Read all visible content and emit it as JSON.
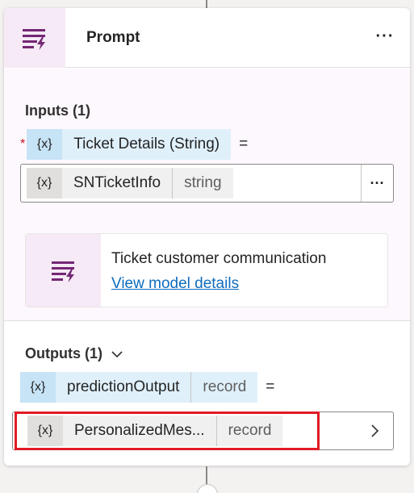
{
  "header": {
    "title": "Prompt",
    "more_label": "···",
    "icon": "prompt-icon"
  },
  "inputs": {
    "label": "Inputs (1)",
    "required_marker": "*",
    "param": {
      "xicon": "{x}",
      "name": "Ticket Details (String)",
      "equals": "="
    },
    "value": {
      "xicon": "{x}",
      "name": "SNTicketInfo",
      "type": "string",
      "more_label": "···"
    }
  },
  "model": {
    "icon": "prompt-icon",
    "name": "Ticket customer communication",
    "link": "View model details"
  },
  "outputs": {
    "label": "Outputs (1)",
    "param": {
      "xicon": "{x}",
      "name": "predictionOutput",
      "type": "record",
      "equals": "="
    },
    "value": {
      "xicon": "{x}",
      "name": "PersonalizedMes...",
      "type": "record"
    }
  },
  "colors": {
    "accent_purple": "#742774",
    "chip_blue": "#dff0fb",
    "highlight_red": "#e01b24",
    "link_blue": "#0f6cbd"
  }
}
